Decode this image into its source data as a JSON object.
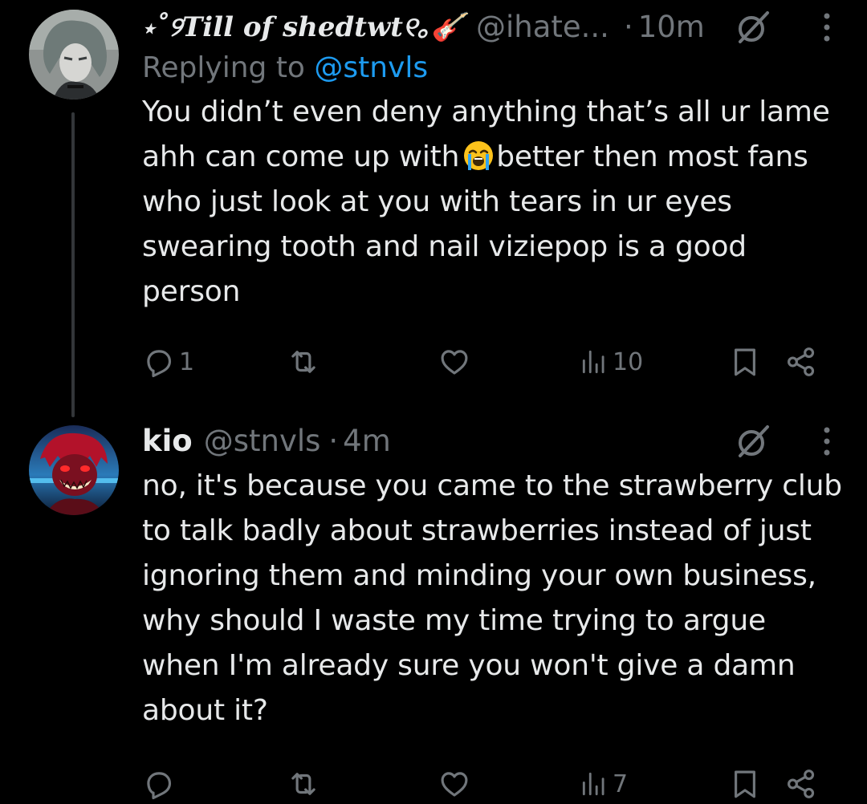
{
  "posts": [
    {
      "display_name": "⋆˚୨Till of shedtwt୧｡🎸",
      "handle": "@ihate...",
      "timestamp": "10m",
      "replying_prefix": "Replying to",
      "replying_to": "@stnvls",
      "text_before_emoji": "You didn’t even deny anything that’s all ur lame ahh can come up with",
      "emoji": "loudly-crying-face",
      "text_after_emoji": "better then most fans who just look at you with tears in ur eyes swearing tooth and nail viziepop is a good person",
      "counts": {
        "replies": "1",
        "retweets": "",
        "likes": "",
        "views": "10"
      }
    },
    {
      "display_name": "kio",
      "handle": "@stnvls",
      "timestamp": "4m",
      "text": "no, it's because you came to the strawberry club to talk badly about strawberries instead of just ignoring them and minding your own business, why should I waste my time trying to argue when I'm already sure you won't give a damn about it?",
      "counts": {
        "replies": "",
        "retweets": "",
        "likes": "",
        "views": "7"
      }
    }
  ],
  "separator": "·",
  "colors": {
    "background": "#000000",
    "text_primary": "#e7e9ea",
    "text_secondary": "#71767b",
    "accent": "#1d9bf0",
    "thread_line": "#333639"
  },
  "icons": [
    "reply-icon",
    "retweet-icon",
    "like-icon",
    "views-icon",
    "bookmark-icon",
    "share-icon",
    "grok-icon",
    "more-icon"
  ]
}
